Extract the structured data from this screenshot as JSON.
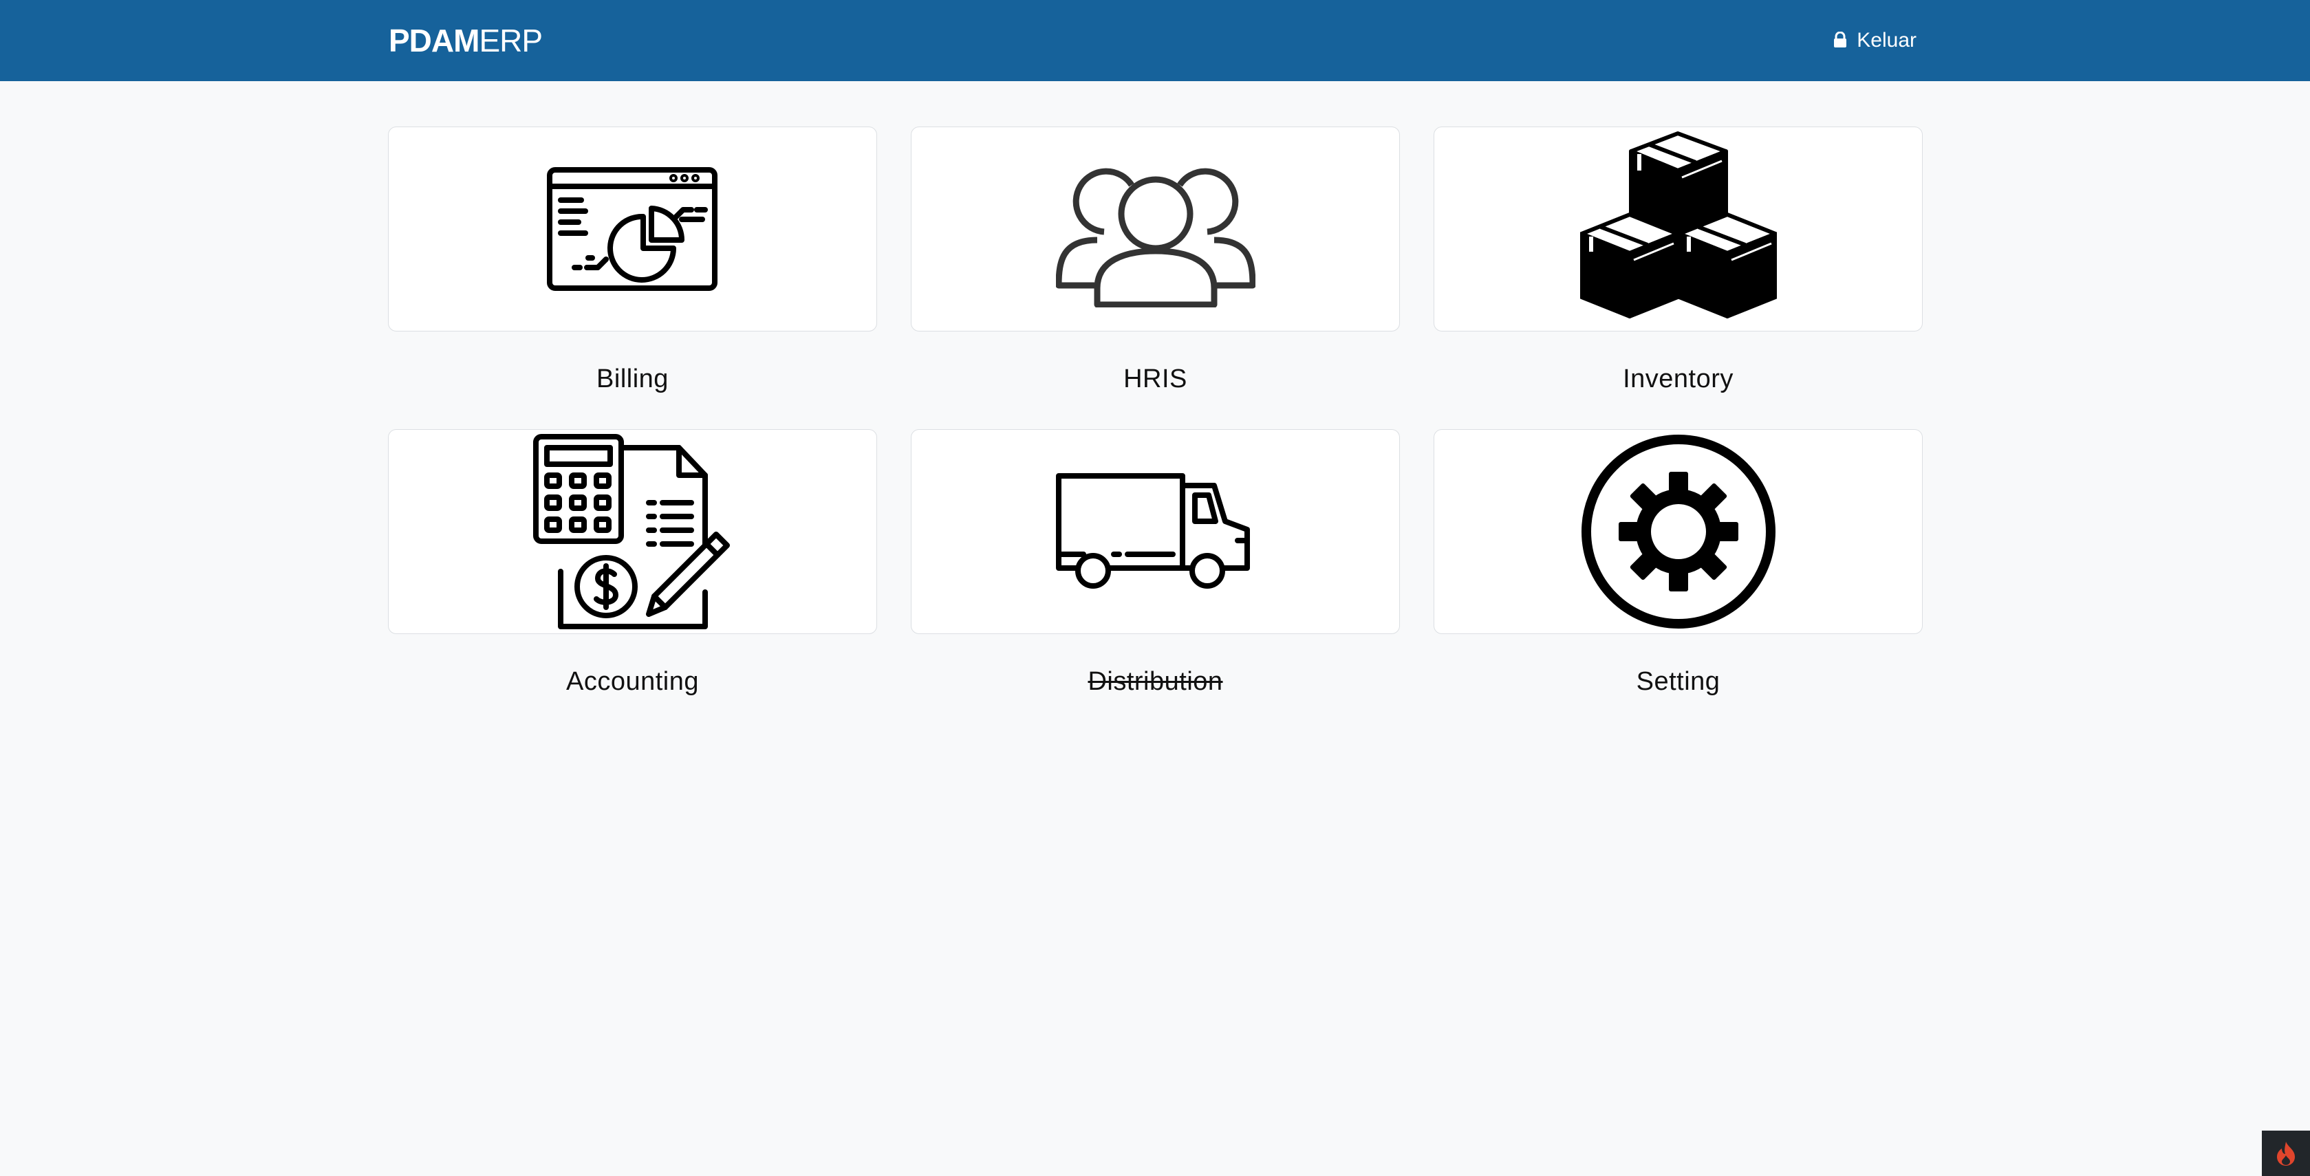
{
  "header": {
    "brand_bold": "PDAM",
    "brand_light": "ERP",
    "logout_label": "Keluar",
    "logout_icon": "lock-icon",
    "background_color": "#16629b"
  },
  "modules": [
    {
      "label": "Billing",
      "icon": "billing-icon",
      "enabled": true
    },
    {
      "label": "HRIS",
      "icon": "users-icon",
      "enabled": true
    },
    {
      "label": "Inventory",
      "icon": "boxes-icon",
      "enabled": true
    },
    {
      "label": "Accounting",
      "icon": "accounting-icon",
      "enabled": true
    },
    {
      "label": "Distribution",
      "icon": "truck-icon",
      "enabled": false
    },
    {
      "label": "Setting",
      "icon": "gear-icon",
      "enabled": true
    }
  ],
  "debug_toolbar": {
    "icon": "flame-icon",
    "accent": "#e0452c"
  }
}
